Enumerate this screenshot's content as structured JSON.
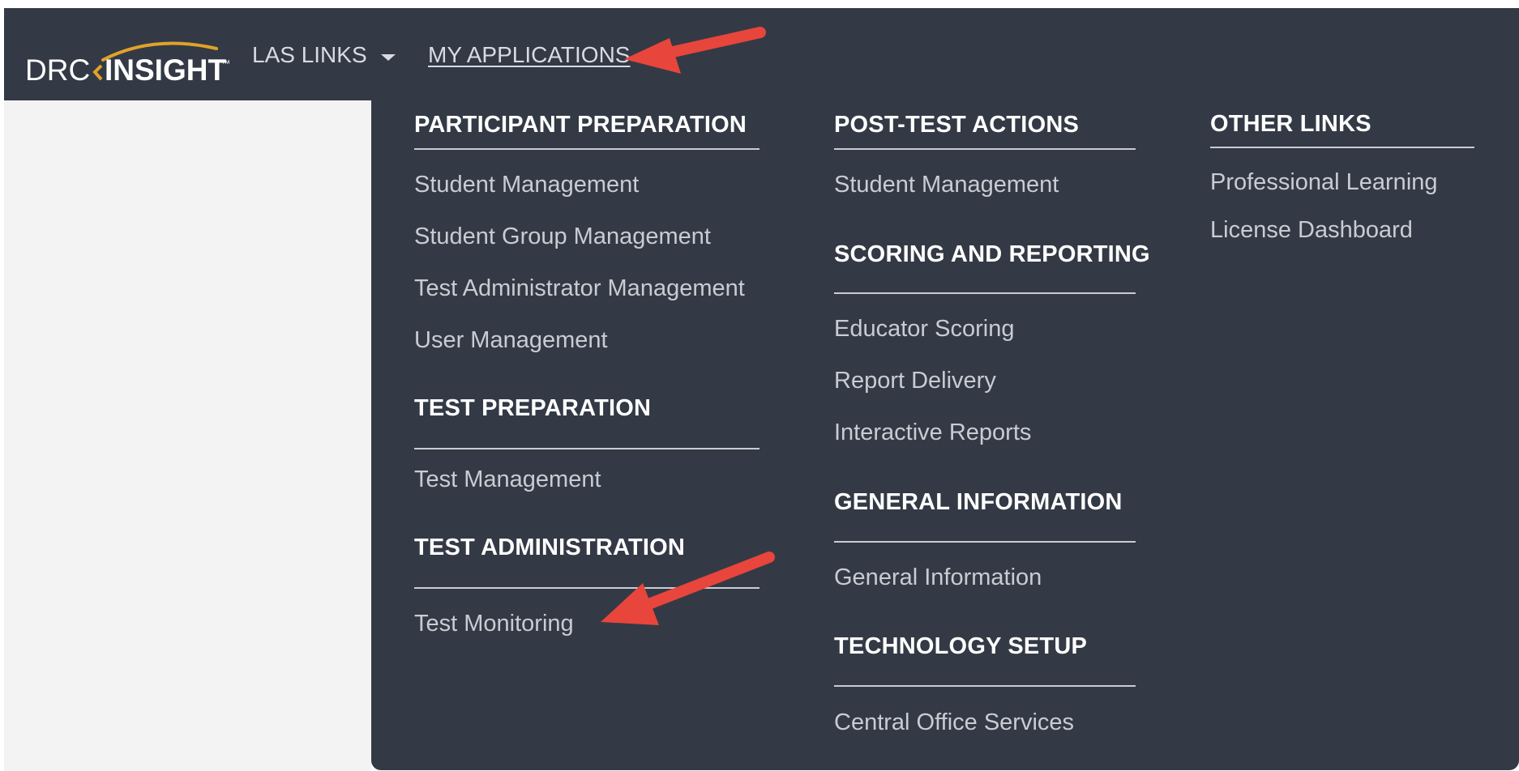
{
  "header": {
    "logo": {
      "text_light": "DRC",
      "text_bold": "INSIGHT",
      "trademark": "™"
    },
    "nav_las_links": "LAS LINKS",
    "nav_my_applications": "MY APPLICATIONS"
  },
  "menu": {
    "col1": {
      "participant_preparation": {
        "title": "PARTICIPANT PREPARATION",
        "links": [
          "Student Management",
          "Student Group Management",
          "Test Administrator Management",
          "User Management"
        ]
      },
      "test_preparation": {
        "title": "TEST PREPARATION",
        "links": [
          "Test Management"
        ]
      },
      "test_administration": {
        "title": "TEST ADMINISTRATION",
        "links": [
          "Test Monitoring"
        ]
      }
    },
    "col2": {
      "post_test_actions": {
        "title": "POST-TEST ACTIONS",
        "links": [
          "Student Management"
        ]
      },
      "scoring_and_reporting": {
        "title": "SCORING AND REPORTING",
        "links": [
          "Educator Scoring",
          "Report Delivery",
          "Interactive Reports"
        ]
      },
      "general_information": {
        "title": "GENERAL INFORMATION",
        "links": [
          "General Information"
        ]
      },
      "technology_setup": {
        "title": "TECHNOLOGY SETUP",
        "links": [
          "Central Office Services"
        ]
      }
    },
    "col3": {
      "other_links": {
        "title": "OTHER LINKS",
        "links": [
          "Professional Learning",
          "License Dashboard"
        ]
      }
    }
  },
  "colors": {
    "header_bg": "#333a45",
    "menu_text": "#c8ccd3",
    "heading_text": "#ffffff",
    "annotation_arrow": "#e8453c",
    "logo_accent": "#e0a22a"
  }
}
